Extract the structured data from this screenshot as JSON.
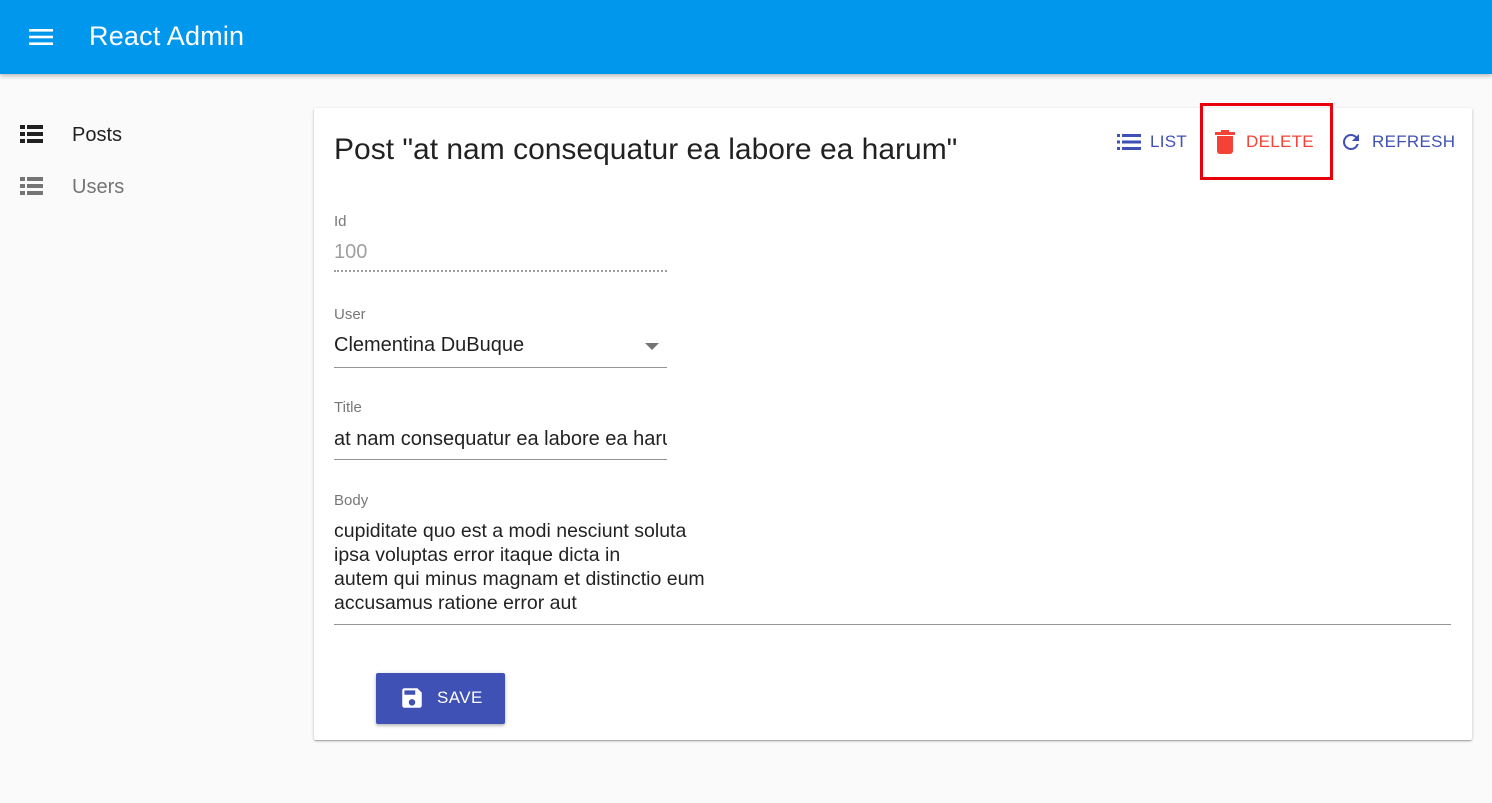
{
  "app": {
    "title": "React Admin",
    "menu_icon": "hamburger-menu-icon",
    "colors": {
      "appbar": "#0097ec",
      "primary": "#3f51b5",
      "danger": "#f44336"
    }
  },
  "sidebar": {
    "items": [
      {
        "label": "Posts",
        "icon": "list-view-icon",
        "active": true
      },
      {
        "label": "Users",
        "icon": "list-view-icon",
        "active": false
      }
    ]
  },
  "page": {
    "title": "Post \"at nam consequatur ea labore ea harum\"",
    "actions": {
      "list": {
        "label": "LIST",
        "icon": "list-icon"
      },
      "delete": {
        "label": "DELETE",
        "icon": "trash-icon"
      },
      "refresh": {
        "label": "REFRESH",
        "icon": "refresh-icon"
      }
    }
  },
  "form": {
    "id": {
      "label": "Id",
      "value": "100"
    },
    "user": {
      "label": "User",
      "value": "Clementina DuBuque"
    },
    "title": {
      "label": "Title",
      "value": "at nam consequatur ea labore ea harum"
    },
    "body": {
      "label": "Body",
      "value": "cupiditate quo est a modi nesciunt soluta\nipsa voluptas error itaque dicta in\nautem qui minus magnam et distinctio eum\naccusamus ratione error aut"
    },
    "save": {
      "label": "SAVE",
      "icon": "save-floppy-icon"
    }
  }
}
